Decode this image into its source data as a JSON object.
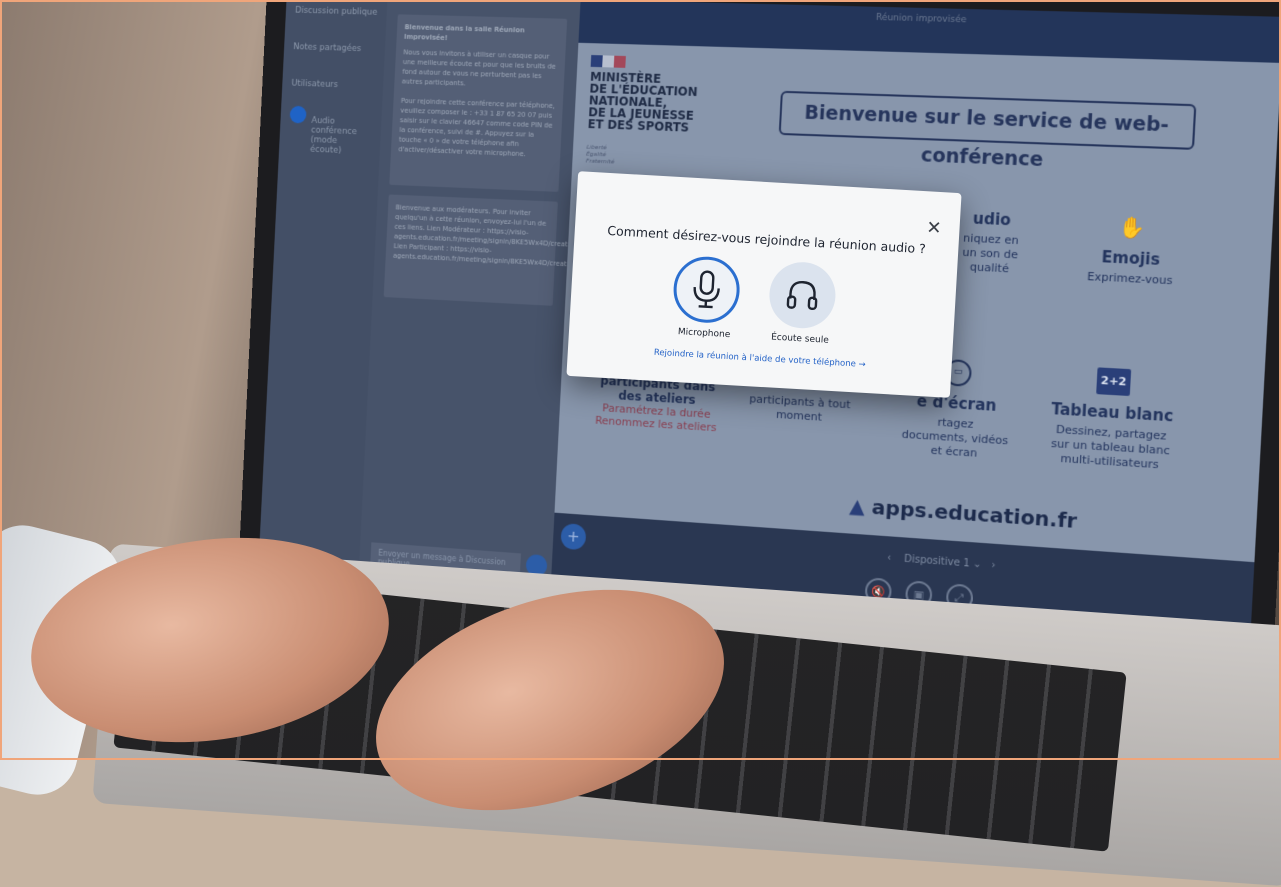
{
  "sidebar": {
    "items": [
      "Discussion publique",
      "Notes partagées",
      "Utilisateurs",
      "Audio conférence (mode écoute)"
    ]
  },
  "chat": {
    "welcome_title": "Bienvenue dans la salle Réunion improvisée!",
    "welcome_text": "Nous vous invitons à utiliser un casque pour une meilleure écoute et pour que les bruits de fond autour de vous ne perturbent pas les autres participants.",
    "phone_text": "Pour rejoindre cette conférence par téléphone, veuillez composer le : +33 1 87 65 20 07 puis saisir sur le clavier 46647 comme code PIN de la conférence, suivi de #. Appuyez sur la touche « 0 » de votre téléphone afin d'activer/désactiver votre microphone.",
    "moderator_text": "Bienvenue aux modérateurs. Pour inviter quelqu'un à cette réunion, envoyez-lui l'un de ces liens. Lien Modérateur : https://visio-agents.education.fr/meeting/signin/8KE5Wx4D/creator/8018/hash/f1dffa5498dd08af6103a2906a0d6b0477779fb Lien Participant : https://visio-agents.education.fr/meeting/signin/8KE5Wx4D/creator/8018/hash/4431705c9cb368a97680569e7779e0e73223fe557",
    "input_placeholder": "Envoyer un message à Discussion publique"
  },
  "topbar": {
    "title": "Réunion improvisée"
  },
  "slide": {
    "ministry": "MINISTÈRE\nDE L'ÉDUCATION\nNATIONALE,\nDE LA JEUNESSE\nET DES SPORTS",
    "devise": "Liberté\nÉgalité\nFraternité",
    "welcome": "Bienvenue sur le service de web-conférence",
    "audio_title": "udio",
    "audio_sub": "niquez en\nun son de\nqualité",
    "emojis_title": "Emojis",
    "emojis_sub": "Exprimez-vous",
    "ateliers_title": "participants dans\ndes ateliers",
    "ateliers_red": "Paramétrez la durée\nRenommez les ateliers",
    "participants_sub": "participants à tout\nmoment",
    "ecran_title": "e d'écran",
    "ecran_sub": "rtagez\ndocuments, vidéos\net écran",
    "tableau_title": "Tableau blanc",
    "tableau_sub": "Dessinez, partagez\nsur un tableau blanc\nmulti-utilisateurs",
    "tableau_icon": "2+2",
    "apps_logo": "apps.education.fr"
  },
  "bottombar": {
    "slide_label": "Dispositive 1"
  },
  "modal": {
    "title": "Comment désirez-vous rejoindre la réunion audio ?",
    "close_icon": "close-icon",
    "microphone_label": "Microphone",
    "listen_label": "Écoute seule",
    "phone_link": "Rejoindre la réunion à l'aide de votre téléphone →"
  },
  "colors": {
    "accent": "#2b6fd0",
    "navy": "#24355e",
    "modal_bg": "#f6f7f8"
  }
}
